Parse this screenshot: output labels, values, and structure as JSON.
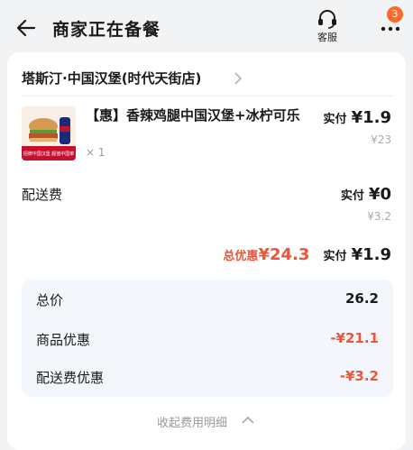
{
  "header": {
    "title": "商家正在备餐",
    "service_label": "客服",
    "badge_count": "3"
  },
  "order": {
    "store_name": "塔斯汀·中国汉堡(时代天街店)",
    "product": {
      "name": "【惠】香辣鸡腿中国汉堡+冰柠可乐",
      "quantity": "× 1",
      "paid_label": "实付",
      "paid_amount": "¥1.9",
      "original_price": "¥23",
      "thumb_text": "招牌中国汉堡 超值中国菜"
    },
    "delivery": {
      "label": "配送费",
      "paid_label": "实付",
      "paid_amount": "¥0",
      "original_price": "¥3.2"
    },
    "summary": {
      "discount_label": "总优惠",
      "discount_amount": "¥24.3",
      "paid_label": "实付",
      "paid_amount": "¥1.9"
    },
    "details": [
      {
        "label": "总价",
        "value": "26.2"
      },
      {
        "label": "商品优惠",
        "value": "-¥21.1"
      },
      {
        "label": "配送费优惠",
        "value": "-¥3.2"
      }
    ],
    "collapse_label": "收起费用明细"
  },
  "colors": {
    "accent": "#e8563b",
    "badge": "#ff6a2b",
    "page_bg": "#f2f3f5",
    "detail_bg": "#f3f6fb"
  },
  "icons": [
    "back-arrow-icon",
    "headset-icon",
    "more-dots-icon",
    "chevron-right-icon",
    "chevron-up-icon"
  ]
}
